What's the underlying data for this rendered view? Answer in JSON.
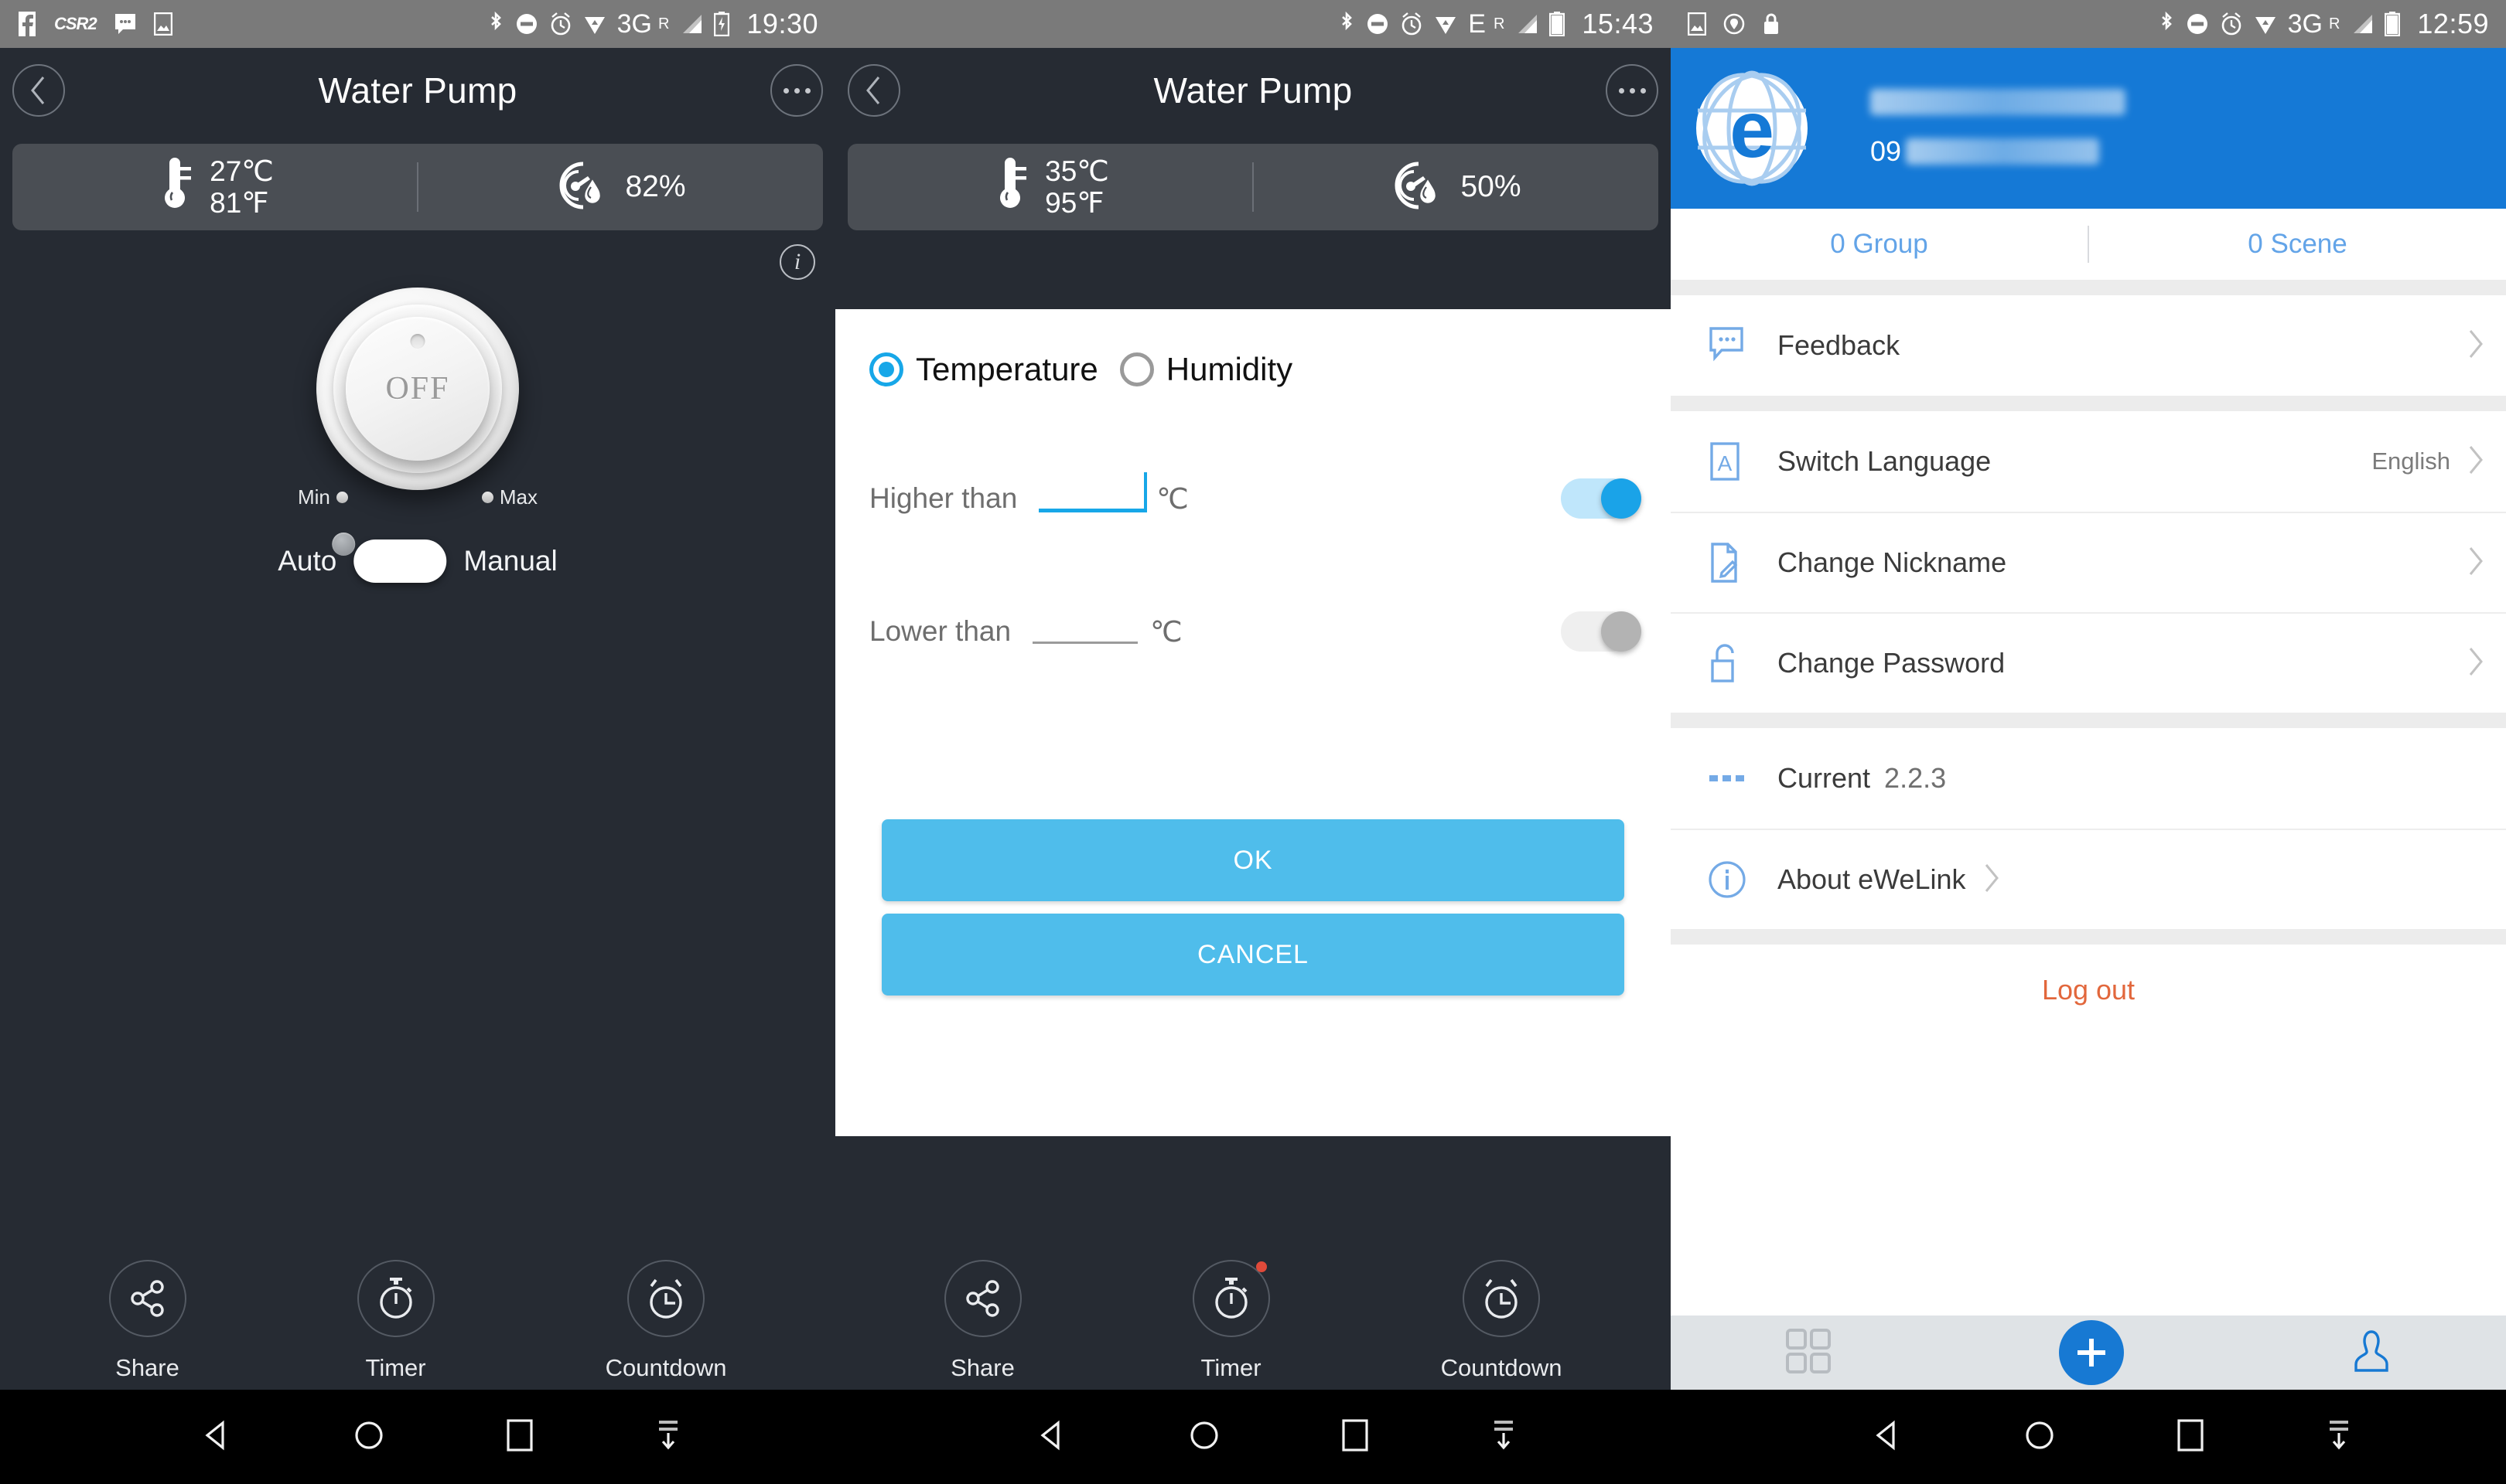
{
  "panels": {
    "left": {
      "statusbar": {
        "left_icons": [
          "facebook-icon",
          "csr2-icon",
          "messenger-icon",
          "gallery-icon"
        ],
        "csr2_label": "CSR2",
        "right_icons": [
          "bluetooth-icon",
          "dnd-icon",
          "alarm-icon",
          "wifi-icon"
        ],
        "network": "3G",
        "network_sup": "R",
        "battery": "battery-charging-icon",
        "time": "19:30"
      },
      "header": {
        "back": "back-icon",
        "title": "Water Pump",
        "more": "more-options-icon"
      },
      "readout": {
        "temp_c": "27℃",
        "temp_f": "81℉",
        "humidity": "82%",
        "temp_icon": "thermometer-icon",
        "hum_icon": "humidity-gauge-icon"
      },
      "info_icon": "info-icon",
      "knob": {
        "state_label": "OFF",
        "min_label": "Min",
        "max_label": "Max"
      },
      "mode": {
        "auto_label": "Auto",
        "manual_label": "Manual",
        "selected": "Manual"
      },
      "actions": [
        {
          "label": "Share",
          "icon": "share-icon",
          "badge": false
        },
        {
          "label": "Timer",
          "icon": "stopwatch-icon",
          "badge": false
        },
        {
          "label": "Countdown",
          "icon": "alarm-clock-icon",
          "badge": false
        }
      ],
      "nav": [
        "back-nav-icon",
        "home-nav-icon",
        "recents-nav-icon",
        "hide-nav-icon"
      ]
    },
    "middle": {
      "statusbar": {
        "right_icons": [
          "bluetooth-icon",
          "dnd-icon",
          "alarm-icon",
          "wifi-icon"
        ],
        "network": "E",
        "network_sup": "R",
        "battery": "battery-icon",
        "time": "15:43"
      },
      "header": {
        "back": "back-icon",
        "title": "Water Pump",
        "more": "more-options-icon"
      },
      "readout": {
        "temp_c": "35℃",
        "temp_f": "95℉",
        "humidity": "50%",
        "temp_icon": "thermometer-icon",
        "hum_icon": "humidity-gauge-icon"
      },
      "dialog": {
        "radios": [
          {
            "label": "Temperature",
            "selected": true
          },
          {
            "label": "Humidity",
            "selected": false
          }
        ],
        "conditions": [
          {
            "label": "Higher than",
            "value": "",
            "unit": "℃",
            "enabled": true
          },
          {
            "label": "Lower than",
            "value": "",
            "unit": "℃",
            "enabled": false
          }
        ],
        "ok_label": "OK",
        "cancel_label": "CANCEL"
      },
      "actions": [
        {
          "label": "Share",
          "icon": "share-icon",
          "badge": false
        },
        {
          "label": "Timer",
          "icon": "stopwatch-icon",
          "badge": true
        },
        {
          "label": "Countdown",
          "icon": "alarm-clock-icon",
          "badge": false
        }
      ],
      "nav": [
        "back-nav-icon",
        "home-nav-icon",
        "recents-nav-icon",
        "hide-nav-icon"
      ]
    },
    "right": {
      "statusbar": {
        "left_icons": [
          "gallery-icon",
          "location-icon",
          "lock-icon"
        ],
        "right_icons": [
          "bluetooth-icon",
          "dnd-icon",
          "alarm-icon",
          "wifi-icon"
        ],
        "network": "3G",
        "network_sup": "R",
        "battery": "battery-icon",
        "time": "12:59"
      },
      "hero": {
        "logo": "ewelink-logo",
        "username_masked": "",
        "account_prefix": "09"
      },
      "tabs": [
        {
          "label": "0 Group"
        },
        {
          "label": "0 Scene"
        }
      ],
      "settings": [
        {
          "label": "Feedback",
          "icon": "feedback-icon",
          "value": "",
          "chevron": true
        },
        {
          "label": "Switch Language",
          "icon": "language-icon",
          "value": "English",
          "chevron": true
        },
        {
          "label": "Change Nickname",
          "icon": "edit-doc-icon",
          "value": "",
          "chevron": true
        },
        {
          "label": "Change Password",
          "icon": "lock-open-icon",
          "value": "",
          "chevron": true
        }
      ],
      "current": {
        "label": "Current",
        "version": "2.2.3",
        "icon": "dots-icon"
      },
      "about": {
        "label": "About eWeLink",
        "icon": "info-circle-icon",
        "chevron": true
      },
      "logout_label": "Log out",
      "bottom_nav": [
        "grid-icon",
        "add-device-icon",
        "profile-icon"
      ],
      "nav": [
        "back-nav-icon",
        "home-nav-icon",
        "recents-nav-icon",
        "hide-nav-icon"
      ]
    }
  },
  "colors": {
    "dark_bg": "#262b33",
    "card_bg": "#4a4e54",
    "accent_blue": "#17a7e8",
    "button_blue": "#4fbdeb",
    "brand_blue": "#1579d6",
    "logout_orange": "#e2673c",
    "statusbar_gray": "#7a7a7a"
  }
}
